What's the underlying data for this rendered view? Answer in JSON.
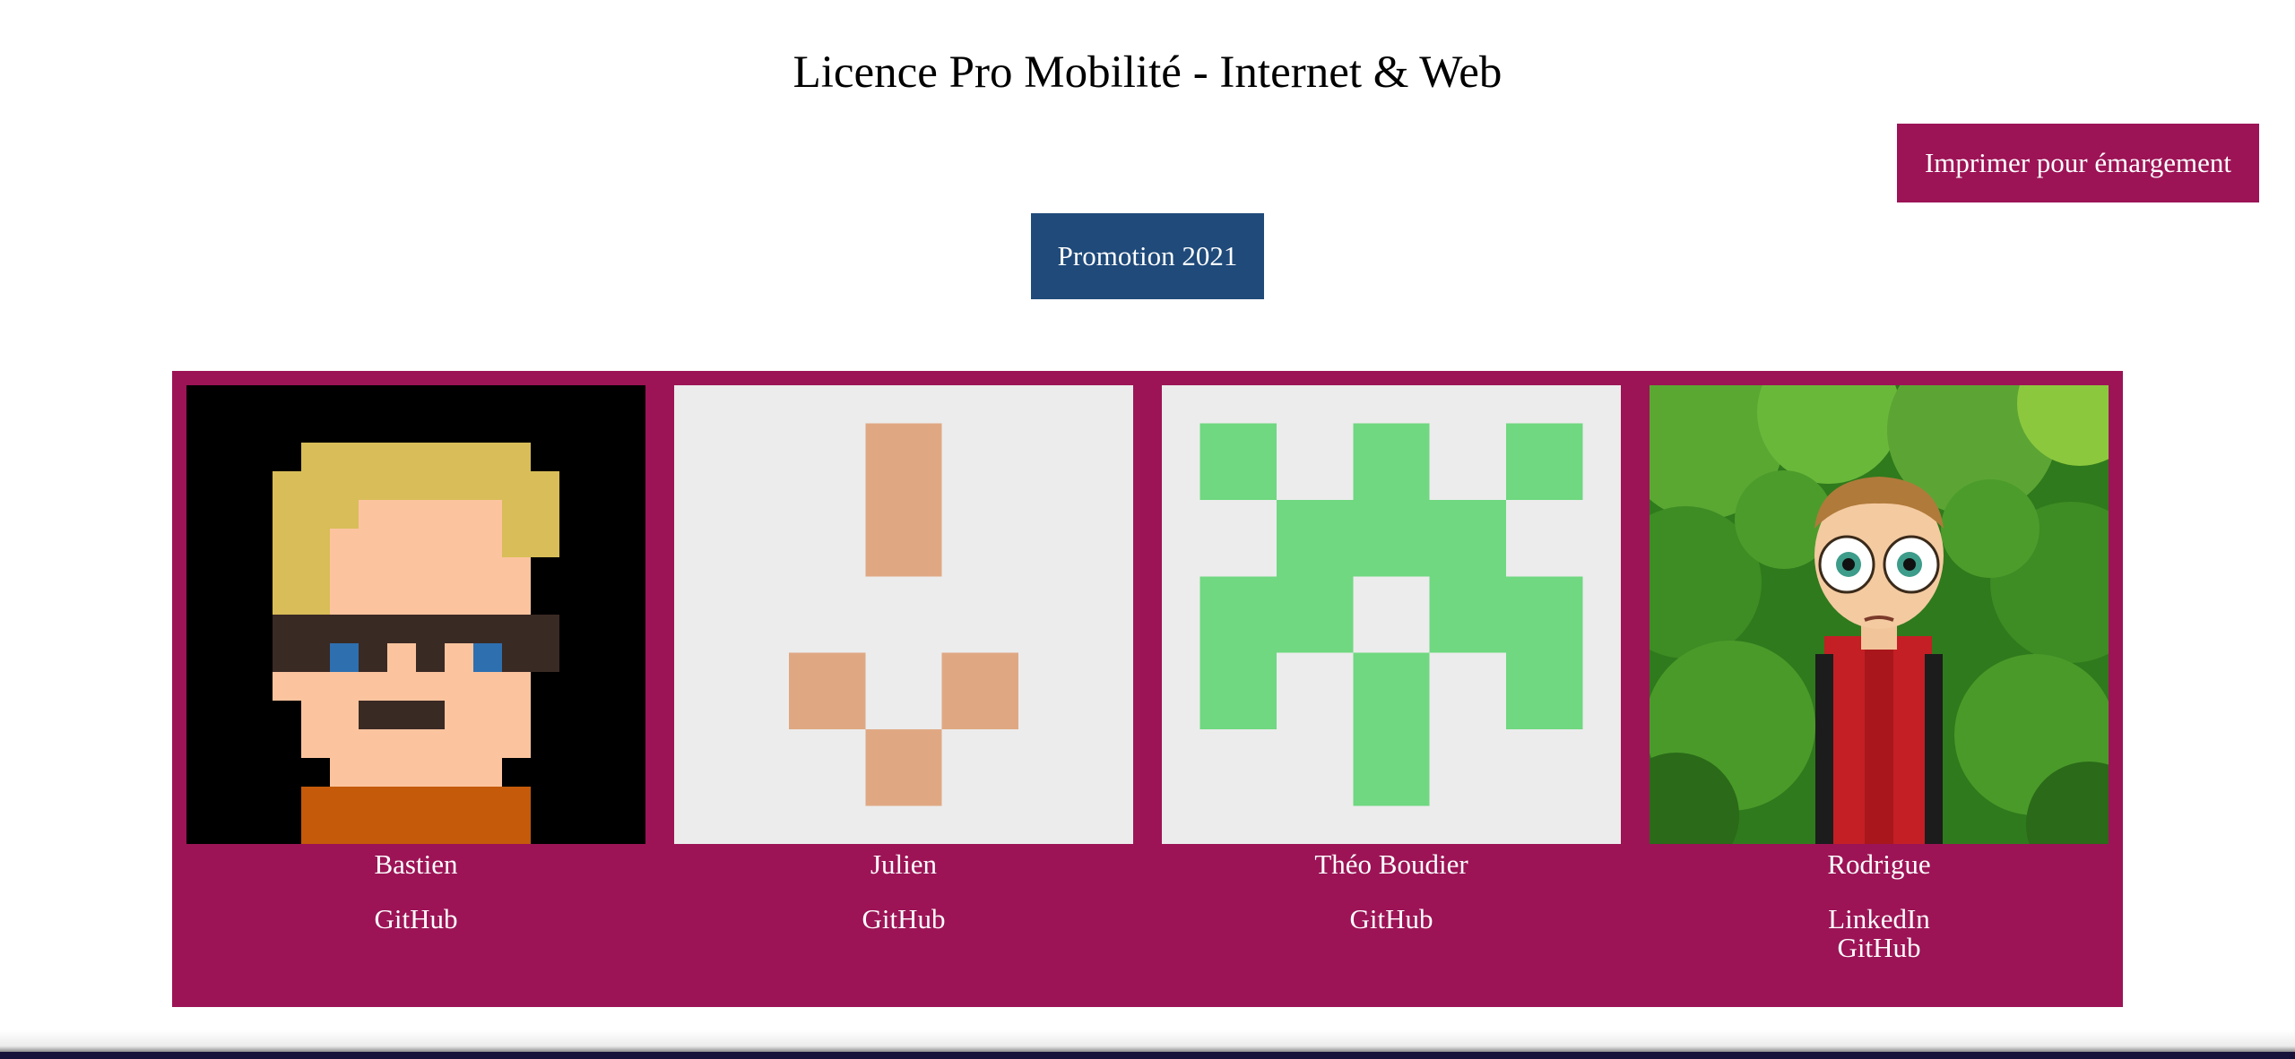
{
  "page": {
    "title": "Licence Pro Mobilité - Internet & Web"
  },
  "toolbar": {
    "print_label": "Imprimer pour émargement",
    "promotion_label": "Promotion 2021"
  },
  "colors": {
    "accent": "#9c1456",
    "promotion": "#1f4a7a"
  },
  "students": [
    {
      "name": "Bastien",
      "links": [
        "GitHub"
      ],
      "avatar": "pixel-art-glasses-avatar"
    },
    {
      "name": "Julien",
      "links": [
        "GitHub"
      ],
      "avatar": "identicon-orange-avatar"
    },
    {
      "name": "Théo Boudier",
      "links": [
        "GitHub"
      ],
      "avatar": "identicon-green-avatar"
    },
    {
      "name": "Rodrigue",
      "links": [
        "LinkedIn",
        "GitHub"
      ],
      "avatar": "cartoon-bitmoji-avatar"
    }
  ]
}
